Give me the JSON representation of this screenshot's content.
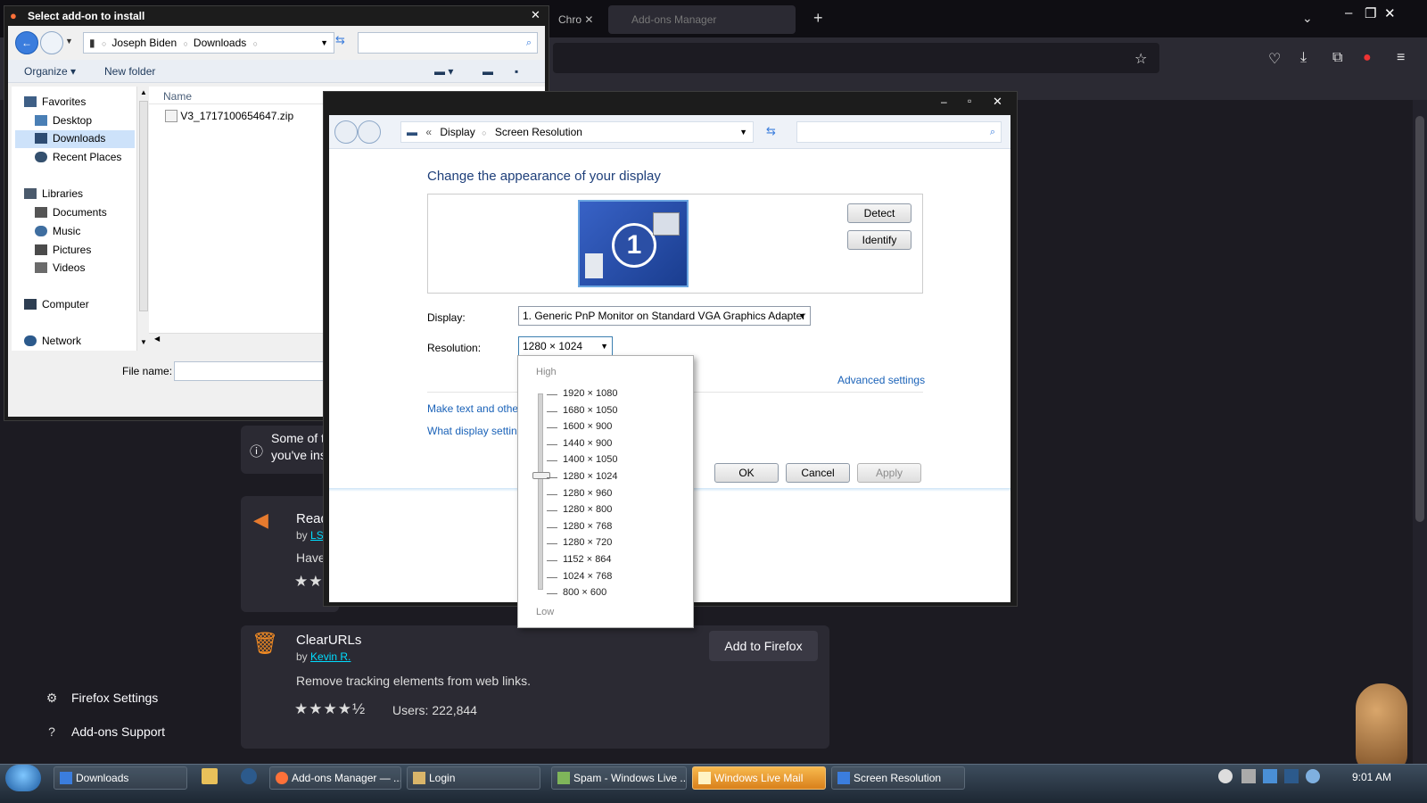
{
  "firefox": {
    "tabs": [
      {
        "label": "Chro"
      },
      {
        "label": "Add-ons Manager"
      }
    ],
    "notice": {
      "line1": "Some of t",
      "line2": "you've ins"
    },
    "addons": [
      {
        "title": "Read",
        "by": "by",
        "author": "LSD",
        "desc": "Have"
      },
      {
        "title": "ClearURLs",
        "by": "by",
        "author": "Kevin R.",
        "desc": "Remove tracking elements from web links.",
        "users": "Users: 222,844",
        "button": "Add to Firefox"
      }
    ],
    "sidebar": {
      "settings": "Firefox Settings",
      "support": "Add-ons Support"
    },
    "colors": {
      "accent_link": "#00ddff",
      "background": "#1c1b22"
    }
  },
  "file_dialog": {
    "title": "Select add-on to install",
    "breadcrumb": [
      "Joseph Biden",
      "Downloads"
    ],
    "toolbar": {
      "organize": "Organize",
      "new_folder": "New folder"
    },
    "column_name": "Name",
    "nav": {
      "favorites": "Favorites",
      "desktop": "Desktop",
      "downloads": "Downloads",
      "recent": "Recent Places",
      "libraries": "Libraries",
      "documents": "Documents",
      "music": "Music",
      "pictures": "Pictures",
      "videos": "Videos",
      "computer": "Computer",
      "network": "Network"
    },
    "files": [
      {
        "name": "V3_1717100654647.zip"
      }
    ],
    "file_name_label": "File name:",
    "file_name_value": ""
  },
  "screen_resolution": {
    "breadcrumb": [
      "Display",
      "Screen Resolution"
    ],
    "heading": "Change the appearance of your display",
    "monitor_number": "1",
    "detect": "Detect",
    "identify": "Identify",
    "display_label": "Display:",
    "display_value": "1. Generic PnP Monitor on Standard VGA Graphics Adapter",
    "resolution_label": "Resolution:",
    "resolution_value": "1280 × 1024",
    "advanced": "Advanced settings",
    "link1": "Make text and other",
    "link2": "What display setting",
    "ok": "OK",
    "cancel": "Cancel",
    "apply": "Apply",
    "dropdown": {
      "high": "High",
      "low": "Low",
      "options": [
        "1920 × 1080",
        "1680 × 1050",
        "1600 × 900",
        "1440 × 900",
        "1400 × 1050",
        "1280 × 1024",
        "1280 × 960",
        "1280 × 800",
        "1280 × 768",
        "1280 × 720",
        "1152 × 864",
        "1024 × 768",
        "800 × 600"
      ],
      "selected": "1280 × 1024"
    }
  },
  "taskbar": {
    "items": [
      {
        "label": "Downloads"
      },
      {
        "label": "Add-ons Manager — ..."
      },
      {
        "label": "Login"
      },
      {
        "label": "Spam - Windows Live ..."
      },
      {
        "label": "Windows Live Mail"
      },
      {
        "label": "Screen Resolution"
      }
    ],
    "clock": "9:01 AM"
  }
}
